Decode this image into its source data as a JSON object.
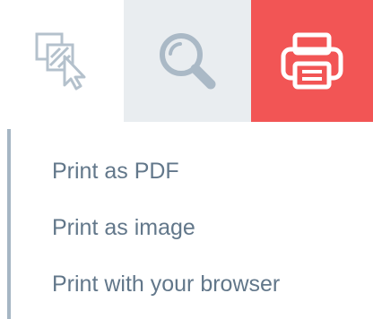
{
  "toolbar": {
    "buttons": [
      {
        "icon": "select-area-icon",
        "active": false
      },
      {
        "icon": "magnifier-icon",
        "active": false
      },
      {
        "icon": "printer-icon",
        "active": true
      }
    ]
  },
  "print_menu": {
    "items": [
      {
        "label": "Print as PDF"
      },
      {
        "label": "Print as image"
      },
      {
        "label": "Print with your browser"
      }
    ]
  },
  "colors": {
    "accent": "#f25555",
    "hover_background": "#e9edf0",
    "icon_gray": "#aab9c6",
    "menu_text": "#62778a",
    "menu_rule": "#a6b6c4"
  }
}
